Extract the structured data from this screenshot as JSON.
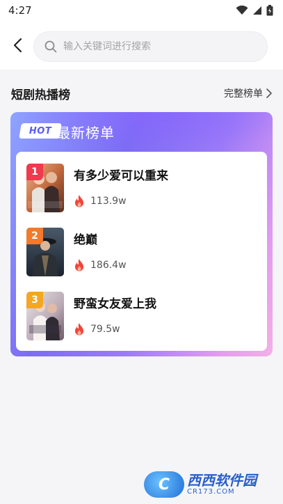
{
  "status_bar": {
    "time": "4:27"
  },
  "search": {
    "placeholder": "输入关键词进行搜索"
  },
  "section": {
    "title": "短剧热播榜",
    "more_label": "完整榜单"
  },
  "card": {
    "badge": "HOT",
    "title": "最新榜单",
    "items": [
      {
        "rank": "1",
        "title": "有多少爱可以重来",
        "heat": "113.9w",
        "badge_color": "#f03a4d"
      },
      {
        "rank": "2",
        "title": "绝巅",
        "heat": "186.4w",
        "badge_color": "#f27a2a"
      },
      {
        "rank": "3",
        "title": "野蛮女友爱上我",
        "heat": "79.5w",
        "badge_color": "#f5a623"
      }
    ]
  },
  "watermark": {
    "main": "西西软件园",
    "sub": "CR173.COM"
  },
  "colors": {
    "accent": "#6a5cf6",
    "fire": "#f0453a"
  }
}
